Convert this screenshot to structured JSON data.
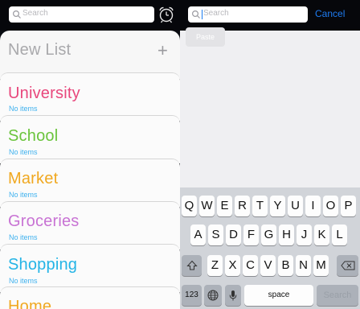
{
  "left": {
    "search_placeholder": "Search",
    "new_list": {
      "label": "New List",
      "plus": "+"
    },
    "lists": [
      {
        "name": "University",
        "status": "No items",
        "color": "#e8477c"
      },
      {
        "name": "School",
        "status": "No items",
        "color": "#6ac43c"
      },
      {
        "name": "Market",
        "status": "No items",
        "color": "#f0a820"
      },
      {
        "name": "Groceries",
        "status": "No items",
        "color": "#c873d4"
      },
      {
        "name": "Shopping",
        "status": "No items",
        "color": "#24b4e6"
      },
      {
        "name": "Home",
        "status": "",
        "color": "#f0a820"
      }
    ],
    "icons": {
      "search": "search-icon",
      "alarm": "alarm-clock-icon"
    }
  },
  "right": {
    "search_placeholder": "Search",
    "cancel_label": "Cancel",
    "paste_label": "Paste",
    "keyboard": {
      "row1": [
        "Q",
        "W",
        "E",
        "R",
        "T",
        "Y",
        "U",
        "I",
        "O",
        "P"
      ],
      "row2": [
        "A",
        "S",
        "D",
        "F",
        "G",
        "H",
        "J",
        "K",
        "L"
      ],
      "row3": [
        "Z",
        "X",
        "C",
        "V",
        "B",
        "N",
        "M"
      ],
      "numbers_label": "123",
      "space_label": "space",
      "search_label": "Search",
      "icons": {
        "shift": "shift-icon",
        "delete": "backspace-icon",
        "globe": "globe-icon",
        "mic": "microphone-icon"
      }
    }
  },
  "colors": {
    "accent": "#1e7cf2",
    "sub_text": "#3eb1ee"
  }
}
